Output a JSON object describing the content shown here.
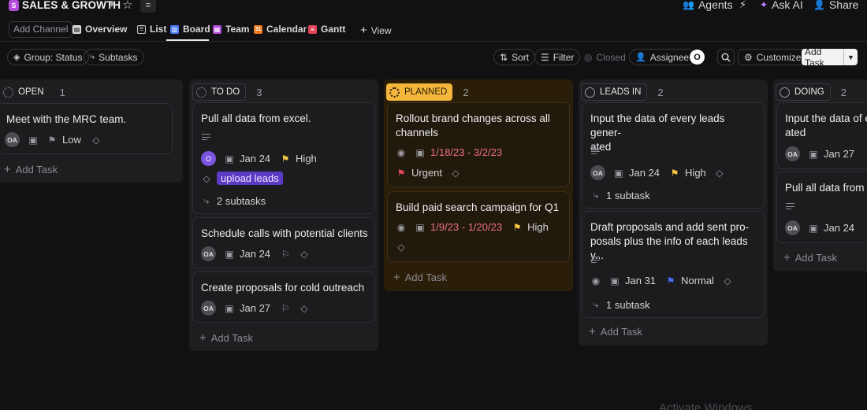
{
  "header": {
    "space_badge": "S",
    "space_name": "SALES & GROWTH",
    "agents": "Agents",
    "ask_ai": "Ask AI",
    "share": "Share"
  },
  "tabs": {
    "add_channel": "Add Channel",
    "items": [
      "Overview",
      "List",
      "Board",
      "Team",
      "Calendar",
      "Gantt"
    ],
    "add_view": "View",
    "active": "Board"
  },
  "toolbar": {
    "group": "Group: Status",
    "subtasks": "Subtasks",
    "sort": "Sort",
    "filter": "Filter",
    "closed": "Closed",
    "assignee": "Assignee",
    "avatar": "O",
    "customize": "Customize",
    "add_task": "Add Task"
  },
  "columns": [
    {
      "status": "OPEN",
      "count": "1",
      "cards": [
        {
          "title": "Meet with the MRC team.",
          "assignee": "OA",
          "priority": "Low"
        }
      ],
      "add_task": "Add Task"
    },
    {
      "status": "TO DO",
      "count": "3",
      "cards": [
        {
          "title": "Pull all data from excel.",
          "assignee": "O",
          "date": "Jan 24",
          "priority": "High",
          "tag": "upload leads",
          "subtasks": "2 subtasks"
        },
        {
          "title": "Schedule calls with potential clients",
          "assignee": "OA",
          "date": "Jan 24"
        },
        {
          "title": "Create proposals for cold outreach",
          "assignee": "OA",
          "date": "Jan 27"
        }
      ],
      "add_task": "Add Task"
    },
    {
      "status": "PLANNED",
      "count": "2",
      "cards": [
        {
          "title": "Rollout brand changes across all channels",
          "date": "1/18/23 - 3/2/23",
          "priority": "Urgent"
        },
        {
          "title": "Build paid search campaign for Q1",
          "date": "1/9/23 - 1/20/23",
          "priority": "High"
        }
      ],
      "add_task": "Add Task"
    },
    {
      "status": "LEADS IN",
      "count": "2",
      "cards": [
        {
          "title_l1": "Input the data of every leads gener-",
          "title_l2": "ated",
          "assignee": "OA",
          "date": "Jan 24",
          "priority": "High",
          "subtasks": "1 subtask"
        },
        {
          "title_l1": "Draft proposals and add sent pro-",
          "title_l2": "posals plus the info of each leads y...",
          "date": "Jan 31",
          "priority": "Normal",
          "subtasks": "1 subtask"
        }
      ],
      "add_task": "Add Task"
    },
    {
      "status": "DOING",
      "count": "2",
      "cards": [
        {
          "title_l1": "Input the data of e",
          "title_l2": "ated",
          "assignee": "OA",
          "date": "Jan 27"
        },
        {
          "title": "Pull all data from e",
          "assignee": "OA",
          "date": "Jan 24"
        }
      ],
      "add_task": "Add Task"
    }
  ],
  "watermark": "Activate Windows"
}
